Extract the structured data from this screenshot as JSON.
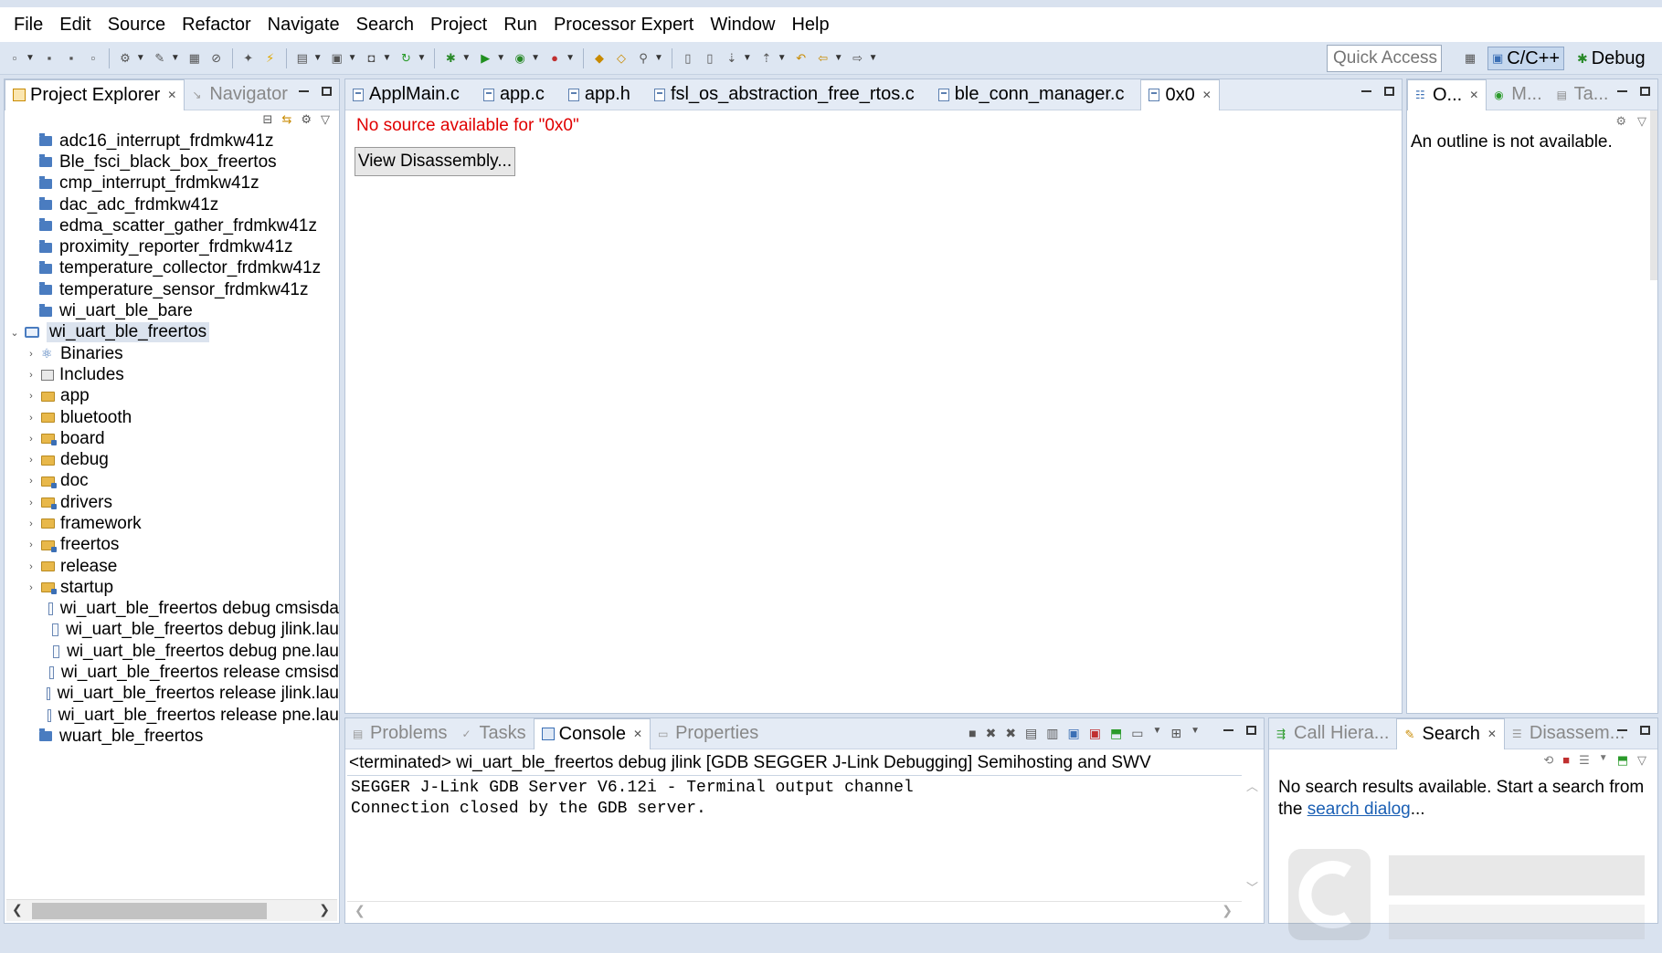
{
  "menu": [
    "File",
    "Edit",
    "Source",
    "Refactor",
    "Navigate",
    "Search",
    "Project",
    "Run",
    "Processor Expert",
    "Window",
    "Help"
  ],
  "toolbar": {
    "quick_access": "Quick Access",
    "perspective_cc": "C/C++",
    "perspective_debug": "Debug"
  },
  "left_panel": {
    "tabs": [
      {
        "label": "Project Explorer",
        "active": true
      },
      {
        "label": "Navigator",
        "active": false
      }
    ],
    "projects_top": [
      "adc16_interrupt_frdmkw41z",
      "Ble_fsci_black_box_freertos",
      "cmp_interrupt_frdmkw41z",
      "dac_adc_frdmkw41z",
      "edma_scatter_gather_frdmkw41z",
      "proximity_reporter_frdmkw41z",
      "temperature_collector_frdmkw41z",
      "temperature_sensor_frdmkw41z",
      "wi_uart_ble_bare"
    ],
    "open_project": "wi_uart_ble_freertos",
    "children": [
      {
        "label": "Binaries",
        "kind": "binaries"
      },
      {
        "label": "Includes",
        "kind": "includes"
      },
      {
        "label": "app",
        "kind": "folder"
      },
      {
        "label": "bluetooth",
        "kind": "folder"
      },
      {
        "label": "board",
        "kind": "src-folder"
      },
      {
        "label": "debug",
        "kind": "folder"
      },
      {
        "label": "doc",
        "kind": "src-folder"
      },
      {
        "label": "drivers",
        "kind": "src-folder"
      },
      {
        "label": "framework",
        "kind": "folder"
      },
      {
        "label": "freertos",
        "kind": "src-folder"
      },
      {
        "label": "release",
        "kind": "folder"
      },
      {
        "label": "startup",
        "kind": "src-folder"
      }
    ],
    "launch_files": [
      "wi_uart_ble_freertos debug cmsisda",
      "wi_uart_ble_freertos debug jlink.lau",
      "wi_uart_ble_freertos debug pne.lau",
      "wi_uart_ble_freertos release cmsisd",
      "wi_uart_ble_freertos release jlink.lau",
      "wi_uart_ble_freertos release pne.lau"
    ],
    "projects_bottom": [
      "wuart_ble_freertos"
    ]
  },
  "editor": {
    "tabs": [
      {
        "label": "ApplMain.c",
        "active": false
      },
      {
        "label": "app.c",
        "active": false
      },
      {
        "label": "app.h",
        "active": false
      },
      {
        "label": "fsl_os_abstraction_free_rtos.c",
        "active": false
      },
      {
        "label": "ble_conn_manager.c",
        "active": false
      },
      {
        "label": "0x0",
        "active": true
      }
    ],
    "error_message": "No source available for \"0x0\"",
    "view_disassembly_button": "View Disassembly..."
  },
  "outline_panel": {
    "tabs": [
      {
        "label": "O...",
        "active": true
      },
      {
        "label": "M...",
        "active": false
      },
      {
        "label": "Ta...",
        "active": false
      }
    ],
    "message": "An outline is not available."
  },
  "console_panel": {
    "tabs": [
      {
        "label": "Problems",
        "active": false
      },
      {
        "label": "Tasks",
        "active": false
      },
      {
        "label": "Console",
        "active": true
      },
      {
        "label": "Properties",
        "active": false
      }
    ],
    "status_line": "<terminated> wi_uart_ble_freertos debug jlink [GDB SEGGER J-Link Debugging] Semihosting and SWV",
    "lines": [
      "SEGGER J-Link GDB Server V6.12i - Terminal output channel",
      "Connection closed by the GDB server."
    ]
  },
  "search_panel": {
    "tabs": [
      {
        "label": "Call Hiera...",
        "active": false
      },
      {
        "label": "Search",
        "active": true
      },
      {
        "label": "Disassem...",
        "active": false
      }
    ],
    "message_prefix": "No search results available. Start a search from",
    "message_the": "the",
    "link": "search dialog",
    "suffix": "..."
  },
  "colors": {
    "error_red": "#e00000",
    "link_blue": "#1a5fb4",
    "chrome": "#d9e2ef"
  }
}
